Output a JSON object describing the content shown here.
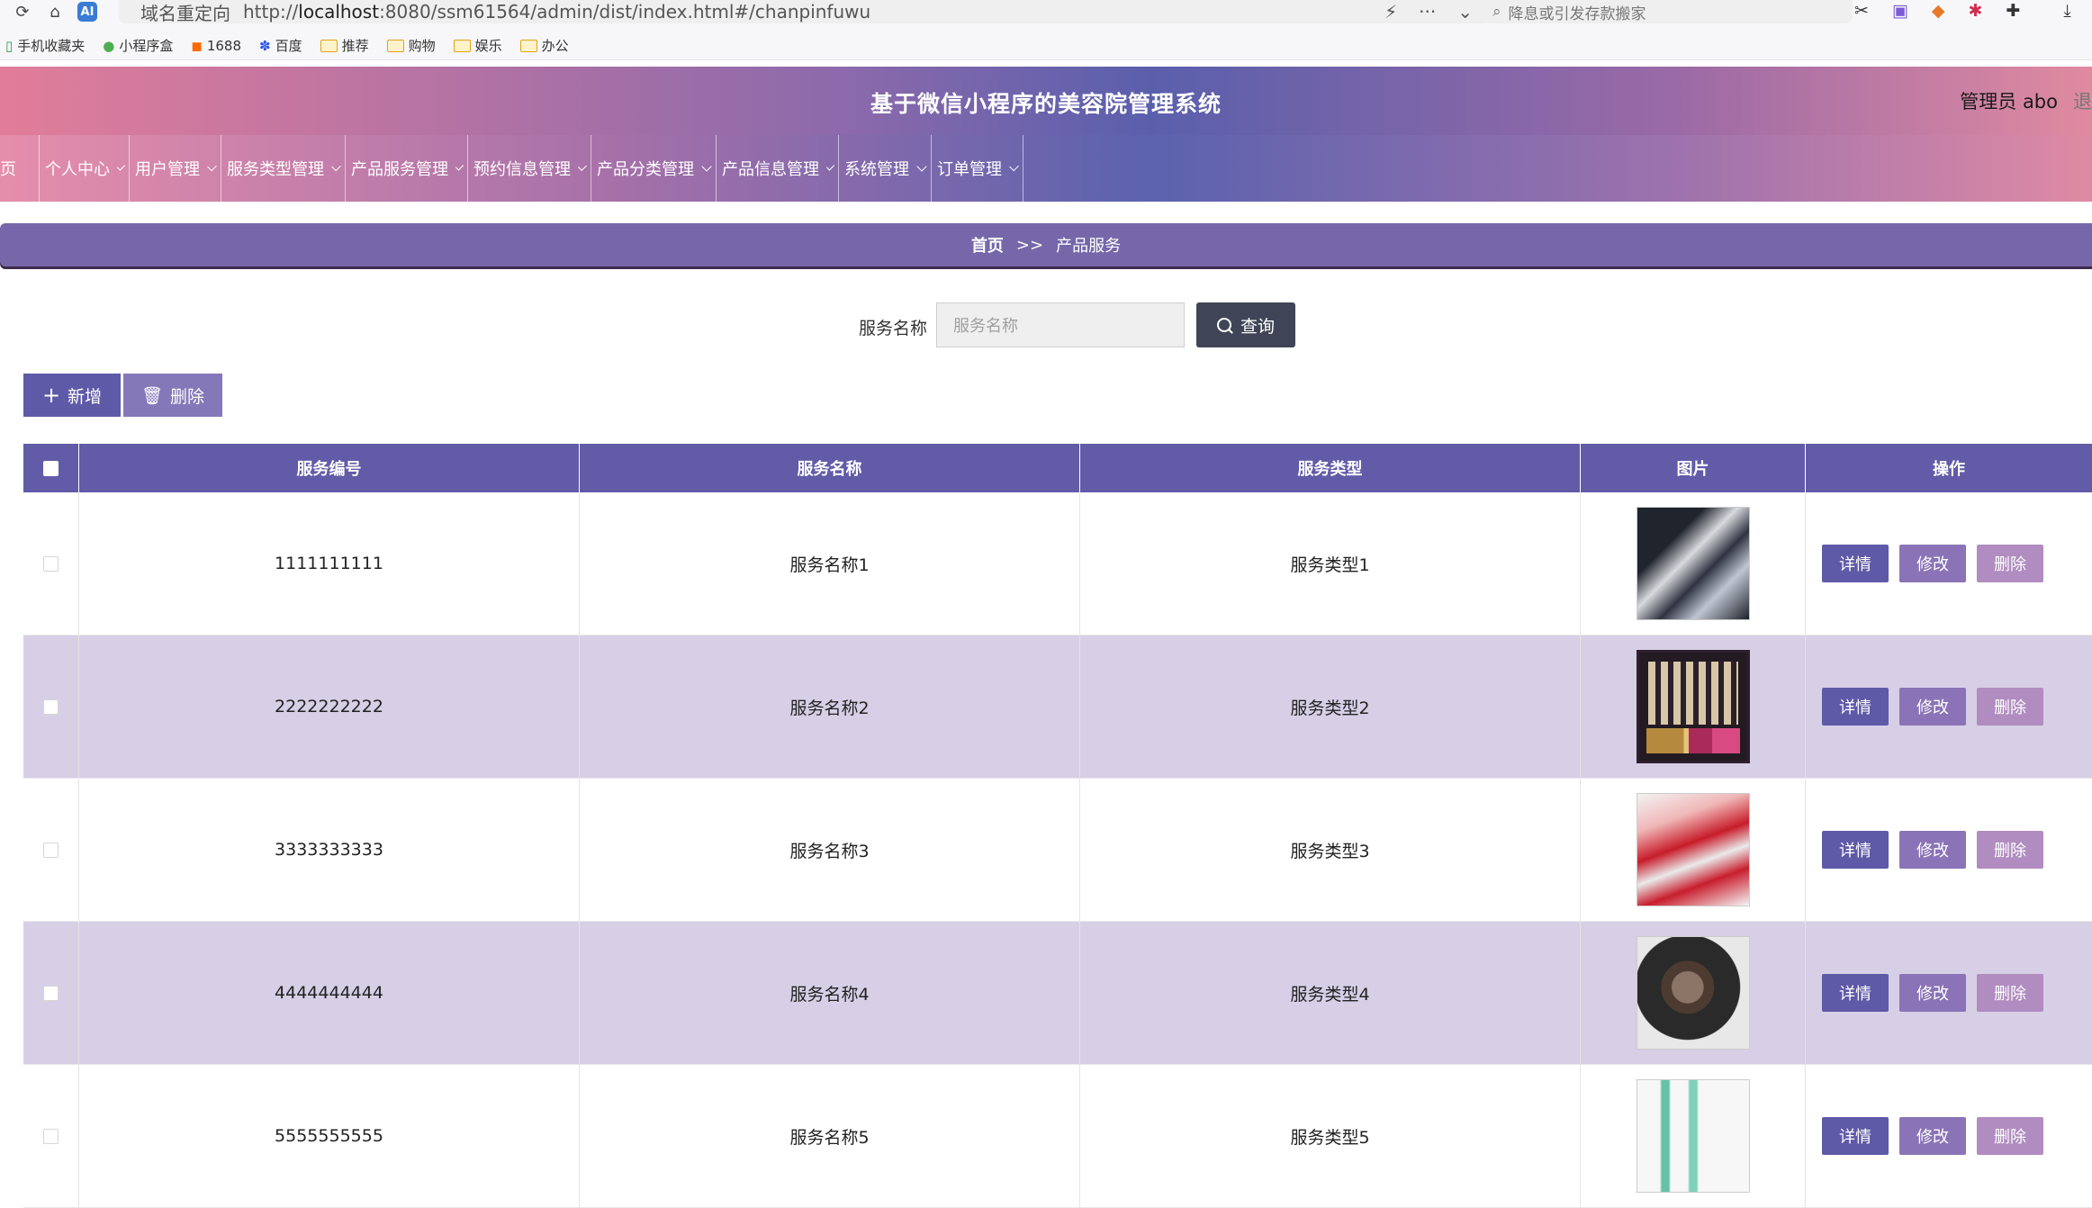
{
  "browser": {
    "redirect_badge": "域名重定向",
    "url_prefix": "http://",
    "url_host": "localhost",
    "url_rest": ":8080/ssm61564/admin/dist/index.html#/chanpinfuwu",
    "search_placeholder": "降息或引发存款搬家",
    "bookmarks": [
      "手机收藏夹",
      "小程序盒",
      "1688",
      "百度",
      "推荐",
      "购物",
      "娱乐",
      "办公"
    ]
  },
  "header": {
    "title": "基于微信小程序的美容院管理系统",
    "admin": "管理员 abo",
    "exit_partial": "退"
  },
  "nav": {
    "items": [
      "页",
      "个人中心",
      "用户管理",
      "服务类型管理",
      "产品服务管理",
      "预约信息管理",
      "产品分类管理",
      "产品信息管理",
      "系统管理",
      "订单管理"
    ]
  },
  "breadcrumb": {
    "home": "首页",
    "sep": ">>",
    "current": "产品服务"
  },
  "search": {
    "label": "服务名称",
    "placeholder": "服务名称",
    "button": "查询"
  },
  "actions": {
    "add": "新增",
    "delete": "删除"
  },
  "table": {
    "headers": [
      "服务编号",
      "服务名称",
      "服务类型",
      "图片",
      "操作"
    ],
    "rows": [
      {
        "code": "1111111111",
        "name": "服务名称1",
        "type": "服务类型1"
      },
      {
        "code": "2222222222",
        "name": "服务名称2",
        "type": "服务类型2"
      },
      {
        "code": "3333333333",
        "name": "服务名称3",
        "type": "服务类型3"
      },
      {
        "code": "4444444444",
        "name": "服务名称4",
        "type": "服务类型4"
      },
      {
        "code": "5555555555",
        "name": "服务名称5",
        "type": "服务类型5"
      }
    ],
    "ops": {
      "detail": "详情",
      "edit": "修改",
      "delete": "删除"
    }
  },
  "colors": {
    "primary": "#615ba8",
    "search_button": "#3f4556",
    "alt_row": "#d6cfe6"
  }
}
